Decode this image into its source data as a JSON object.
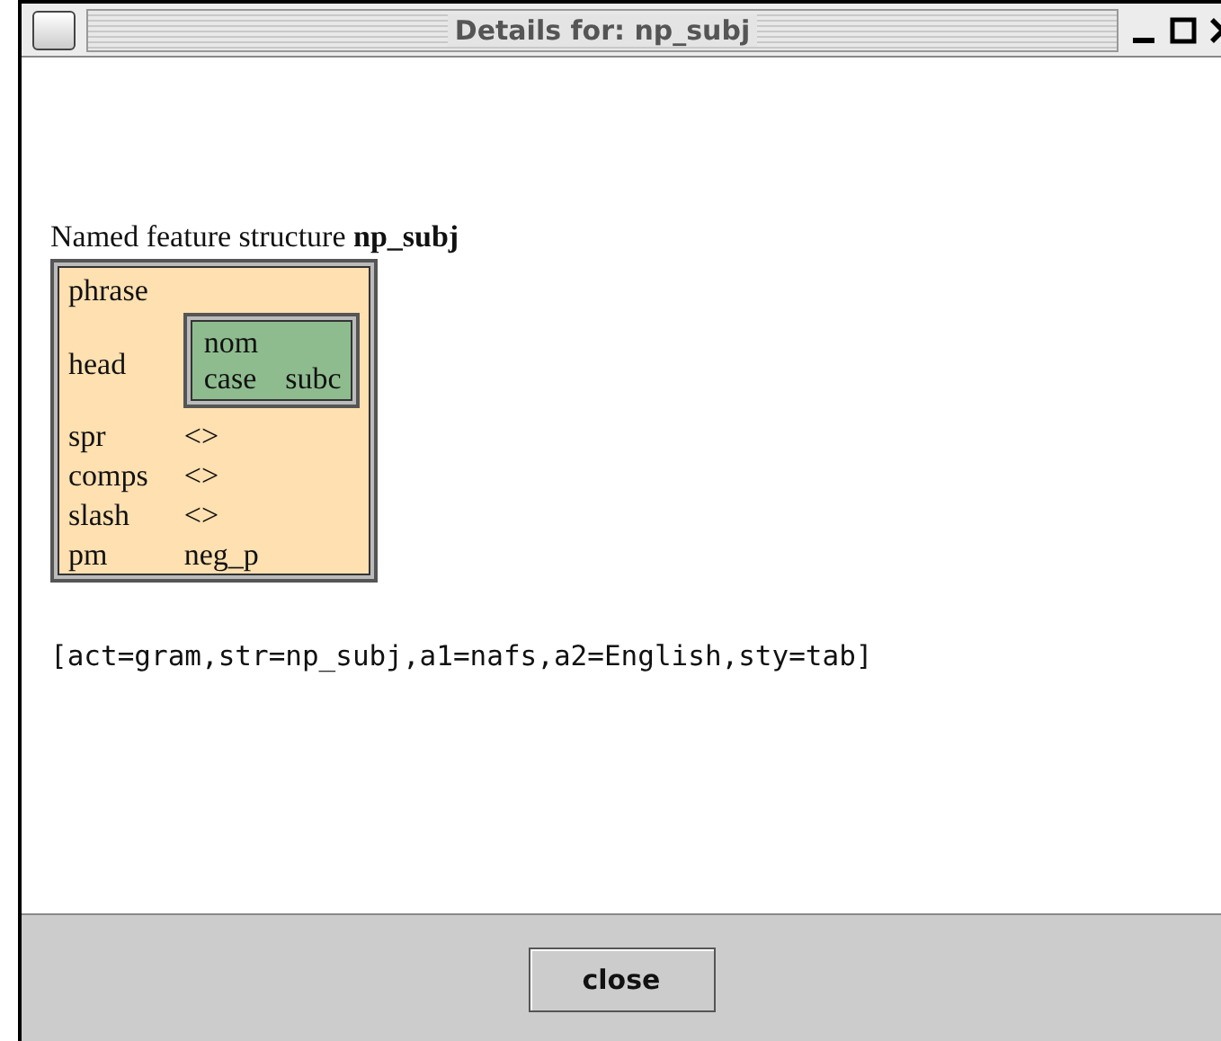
{
  "window": {
    "title": "Details for: np_subj"
  },
  "heading": "Named feature structure **np_subj**",
  "structure": {
    "type": "phrase",
    "features": [
      {
        "name": "head",
        "value": {
          "kind": "avm",
          "type": "nom",
          "features": [
            {
              "name": "case",
              "value": {
                "kind": "atom",
                "text": "subc"
              }
            }
          ]
        }
      },
      {
        "name": "spr",
        "value": {
          "kind": "atom",
          "text": "<>"
        }
      },
      {
        "name": "comps",
        "value": {
          "kind": "atom",
          "text": "<>"
        }
      },
      {
        "name": "slash",
        "value": {
          "kind": "atom",
          "text": "<>"
        }
      },
      {
        "name": "pm",
        "value": {
          "kind": "atom",
          "text": "neg_p"
        }
      }
    ]
  },
  "command": "[act=gram,str=np_subj,a1=nafs,a2=English,sty=tab]",
  "buttons": [
    "close"
  ]
}
